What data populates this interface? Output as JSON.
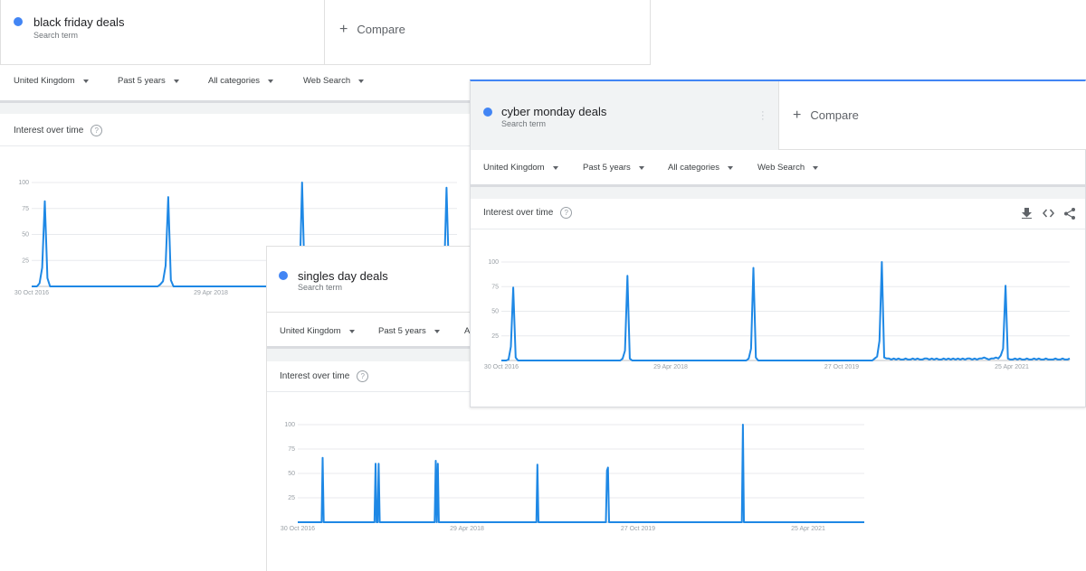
{
  "colors": {
    "series": "#1e88e5",
    "dot": "#4285f4"
  },
  "bf": {
    "term": "black friday deals",
    "term_sub": "Search term",
    "compare": "Compare",
    "filters": [
      "United Kingdom",
      "Past 5 years",
      "All categories",
      "Web Search"
    ],
    "iot_title": "Interest over time",
    "chart_data": {
      "type": "line",
      "title": "",
      "xlabel": "",
      "ylabel": "",
      "yticks": [
        100,
        75,
        50,
        25
      ],
      "ylim": [
        0,
        100
      ],
      "x_ticks": [
        "30 Oct 2016",
        "29 Apr 2018"
      ],
      "series": [
        {
          "values": [
            0,
            0,
            0,
            3,
            18,
            82,
            8,
            0,
            0,
            0,
            0,
            0,
            0,
            0,
            0,
            0,
            0,
            0,
            0,
            0,
            0,
            0,
            0,
            0,
            0,
            0,
            0,
            0,
            0,
            0,
            0,
            0,
            0,
            0,
            0,
            0,
            0,
            0,
            0,
            0,
            0,
            0,
            0,
            0,
            0,
            0,
            0,
            0,
            0,
            2,
            5,
            20,
            86,
            6,
            0,
            0,
            0,
            0,
            0,
            0,
            0,
            0,
            0,
            0,
            0,
            0,
            0,
            0,
            0,
            0,
            0,
            0,
            0,
            0,
            0,
            0,
            0,
            0,
            0,
            0,
            0,
            0,
            0,
            0,
            0,
            0,
            0,
            0,
            0,
            0,
            0,
            0,
            0,
            0,
            0,
            0,
            0,
            0,
            0,
            0,
            0,
            0,
            0,
            100,
            3,
            0,
            0,
            0,
            0,
            0,
            0,
            0,
            0,
            0,
            0,
            0,
            0,
            0,
            0,
            0,
            0,
            0,
            0,
            0,
            0,
            0,
            0,
            0,
            0,
            0,
            0,
            0,
            0,
            0,
            0,
            0,
            0,
            0,
            0,
            0,
            0,
            0,
            0,
            0,
            0,
            0,
            0,
            0,
            0,
            0,
            0,
            0,
            0,
            0,
            0,
            0,
            0,
            2,
            95,
            4,
            0,
            0,
            0
          ]
        }
      ]
    }
  },
  "cm": {
    "term": "cyber monday deals",
    "term_sub": "Search term",
    "compare": "Compare",
    "filters": [
      "United Kingdom",
      "Past 5 years",
      "All categories",
      "Web Search"
    ],
    "iot_title": "Interest over time",
    "chart_data": {
      "type": "line",
      "title": "",
      "xlabel": "",
      "ylabel": "",
      "yticks": [
        100,
        75,
        50,
        25
      ],
      "ylim": [
        0,
        100
      ],
      "x_ticks": [
        "30 Oct 2016",
        "29 Apr 2018",
        "27 Oct 2019",
        "25 Apr 2021"
      ],
      "series": [
        {
          "values": [
            0,
            0,
            0,
            1,
            14,
            74,
            3,
            0,
            0,
            0,
            0,
            0,
            0,
            0,
            0,
            0,
            0,
            0,
            0,
            0,
            0,
            0,
            0,
            0,
            0,
            0,
            0,
            0,
            0,
            0,
            0,
            0,
            0,
            0,
            0,
            0,
            0,
            0,
            0,
            0,
            0,
            0,
            0,
            0,
            0,
            0,
            0,
            0,
            0,
            0,
            0,
            2,
            10,
            86,
            2,
            0,
            0,
            0,
            0,
            0,
            0,
            0,
            0,
            0,
            0,
            0,
            0,
            0,
            0,
            0,
            0,
            0,
            0,
            0,
            0,
            0,
            0,
            0,
            0,
            0,
            0,
            0,
            0,
            0,
            0,
            0,
            0,
            0,
            0,
            0,
            0,
            0,
            0,
            0,
            0,
            0,
            0,
            0,
            0,
            0,
            0,
            0,
            0,
            0,
            2,
            12,
            94,
            3,
            0,
            0,
            0,
            0,
            0,
            0,
            0,
            0,
            0,
            0,
            0,
            0,
            0,
            0,
            0,
            0,
            0,
            0,
            0,
            0,
            0,
            0,
            0,
            0,
            0,
            0,
            0,
            0,
            0,
            0,
            0,
            0,
            0,
            0,
            0,
            0,
            0,
            0,
            0,
            0,
            0,
            0,
            0,
            0,
            0,
            0,
            0,
            0,
            0,
            2,
            4,
            20,
            100,
            3,
            2,
            2,
            1,
            2,
            1,
            2,
            1,
            1,
            2,
            1,
            1,
            2,
            1,
            2,
            1,
            1,
            2,
            2,
            1,
            2,
            1,
            2,
            1,
            1,
            2,
            1,
            2,
            1,
            2,
            1,
            2,
            1,
            2,
            1,
            2,
            2,
            1,
            2,
            1,
            2,
            2,
            3,
            2,
            1,
            2,
            2,
            3,
            2,
            5,
            12,
            76,
            2,
            1,
            1,
            2,
            1,
            2,
            1,
            1,
            2,
            1,
            1,
            2,
            1,
            2,
            1,
            1,
            2,
            1,
            1,
            1,
            2,
            1,
            1,
            2,
            1,
            1,
            2
          ]
        }
      ]
    }
  },
  "sd": {
    "term": "singles day deals",
    "term_sub": "Search term",
    "filters": [
      "United Kingdom",
      "Past 5 years",
      "Al"
    ],
    "iot_title": "Interest over time",
    "chart_data": {
      "type": "line",
      "title": "",
      "xlabel": "",
      "ylabel": "",
      "yticks": [
        100,
        75,
        50,
        25
      ],
      "ylim": [
        0,
        100
      ],
      "x_ticks": [
        "30 Oct 2016",
        "29 Apr 2018",
        "27 Oct 2019",
        "25 Apr 2021"
      ],
      "series": [
        {
          "values": [
            0,
            0,
            0,
            0,
            0,
            0,
            0,
            0,
            0,
            0,
            0,
            0,
            0,
            0,
            0,
            0,
            0,
            0,
            0,
            0,
            0,
            0,
            0,
            0,
            66,
            0,
            0,
            0,
            0,
            0,
            0,
            0,
            0,
            0,
            0,
            0,
            0,
            0,
            0,
            0,
            0,
            0,
            0,
            0,
            0,
            0,
            0,
            0,
            0,
            0,
            0,
            0,
            0,
            0,
            0,
            0,
            0,
            0,
            0,
            0,
            0,
            0,
            0,
            0,
            0,
            0,
            0,
            0,
            0,
            0,
            0,
            0,
            0,
            0,
            0,
            60,
            0,
            0,
            60,
            0,
            0,
            0,
            0,
            0,
            0,
            0,
            0,
            0,
            0,
            0,
            0,
            0,
            0,
            0,
            0,
            0,
            0,
            0,
            0,
            0,
            0,
            0,
            0,
            0,
            0,
            0,
            0,
            0,
            0,
            0,
            0,
            0,
            0,
            0,
            0,
            0,
            0,
            0,
            0,
            0,
            0,
            0,
            0,
            0,
            0,
            0,
            0,
            0,
            0,
            0,
            0,
            0,
            0,
            63,
            0,
            60,
            0,
            0,
            0,
            0,
            0,
            0,
            0,
            0,
            0,
            0,
            0,
            0,
            0,
            0,
            0,
            0,
            0,
            0,
            0,
            0,
            0,
            0,
            0,
            0,
            0,
            0,
            0,
            0,
            0,
            0,
            0,
            0,
            0,
            0,
            0,
            0,
            0,
            0,
            0,
            0,
            0,
            0,
            0,
            0,
            0,
            0,
            0,
            0,
            0,
            0,
            0,
            0,
            0,
            0,
            0,
            0,
            0,
            0,
            0,
            0,
            0,
            0,
            0,
            0,
            0,
            0,
            0,
            0,
            0,
            0,
            0,
            0,
            0,
            0,
            0,
            0,
            0,
            0,
            0,
            0,
            0,
            0,
            0,
            0,
            0,
            0,
            0,
            0,
            0,
            0,
            0,
            0,
            0,
            0,
            0,
            59,
            0,
            0,
            0,
            0,
            0,
            0,
            0,
            0,
            0,
            0,
            0,
            0,
            0,
            0,
            0,
            0,
            0,
            0,
            0,
            0,
            0,
            0,
            0,
            0,
            0,
            0,
            0,
            0,
            0,
            0,
            0,
            0,
            0,
            0,
            0,
            0,
            0,
            0,
            0,
            0,
            0,
            0,
            0,
            0,
            0,
            0,
            0,
            0,
            0,
            0,
            0,
            0,
            0,
            0,
            0,
            0,
            0,
            0,
            0,
            0,
            0,
            0,
            0,
            0,
            0,
            0,
            53,
            56,
            0,
            0,
            0,
            0,
            0,
            0,
            0,
            0,
            0,
            0,
            0,
            0,
            0,
            0,
            0,
            0,
            0,
            0,
            0,
            0,
            0,
            0,
            0,
            0,
            0,
            0,
            0,
            0,
            0,
            0,
            0,
            0,
            0,
            0,
            0,
            0,
            0,
            0,
            0,
            0,
            0,
            0,
            0,
            0,
            0,
            0,
            0,
            0,
            0,
            0,
            0,
            0,
            0,
            0,
            0,
            0,
            0,
            0,
            0,
            0,
            0,
            0,
            0,
            0,
            0,
            0,
            0,
            0,
            0,
            0,
            0,
            0,
            0,
            0,
            0,
            0,
            0,
            0,
            0,
            0,
            0,
            0,
            0,
            0,
            0,
            0,
            0,
            0,
            0,
            0,
            0,
            0,
            0,
            0,
            0,
            0,
            0,
            0,
            0,
            0,
            0,
            0,
            0,
            0,
            0,
            0,
            0,
            0,
            0,
            0,
            0,
            0,
            0,
            0,
            0,
            0,
            0,
            0,
            0,
            0,
            0,
            0,
            0,
            0,
            0,
            0,
            0,
            0,
            0,
            100,
            0,
            0,
            0,
            0,
            0,
            0,
            0,
            0,
            0,
            0,
            0,
            0,
            0,
            0,
            0,
            0,
            0,
            0,
            0,
            0,
            0,
            0,
            0,
            0,
            0,
            0,
            0,
            0,
            0,
            0,
            0,
            0,
            0,
            0,
            0,
            0,
            0,
            0,
            0,
            0,
            0,
            0,
            0,
            0,
            0,
            0,
            0,
            0,
            0,
            0,
            0,
            0,
            0,
            0,
            0,
            0,
            0,
            0,
            0,
            0,
            0,
            0,
            0,
            0,
            0,
            0,
            0,
            0,
            0,
            0,
            0,
            0,
            0,
            0,
            0,
            0,
            0,
            0,
            0,
            0,
            0,
            0,
            0,
            0,
            0,
            0,
            0,
            0,
            0,
            0,
            0,
            0,
            0,
            0,
            0,
            0,
            0,
            0,
            0,
            0,
            0,
            0,
            0,
            0,
            0,
            0,
            0,
            0,
            0,
            0,
            0,
            0,
            0,
            0,
            0,
            0,
            0
          ]
        }
      ]
    }
  }
}
